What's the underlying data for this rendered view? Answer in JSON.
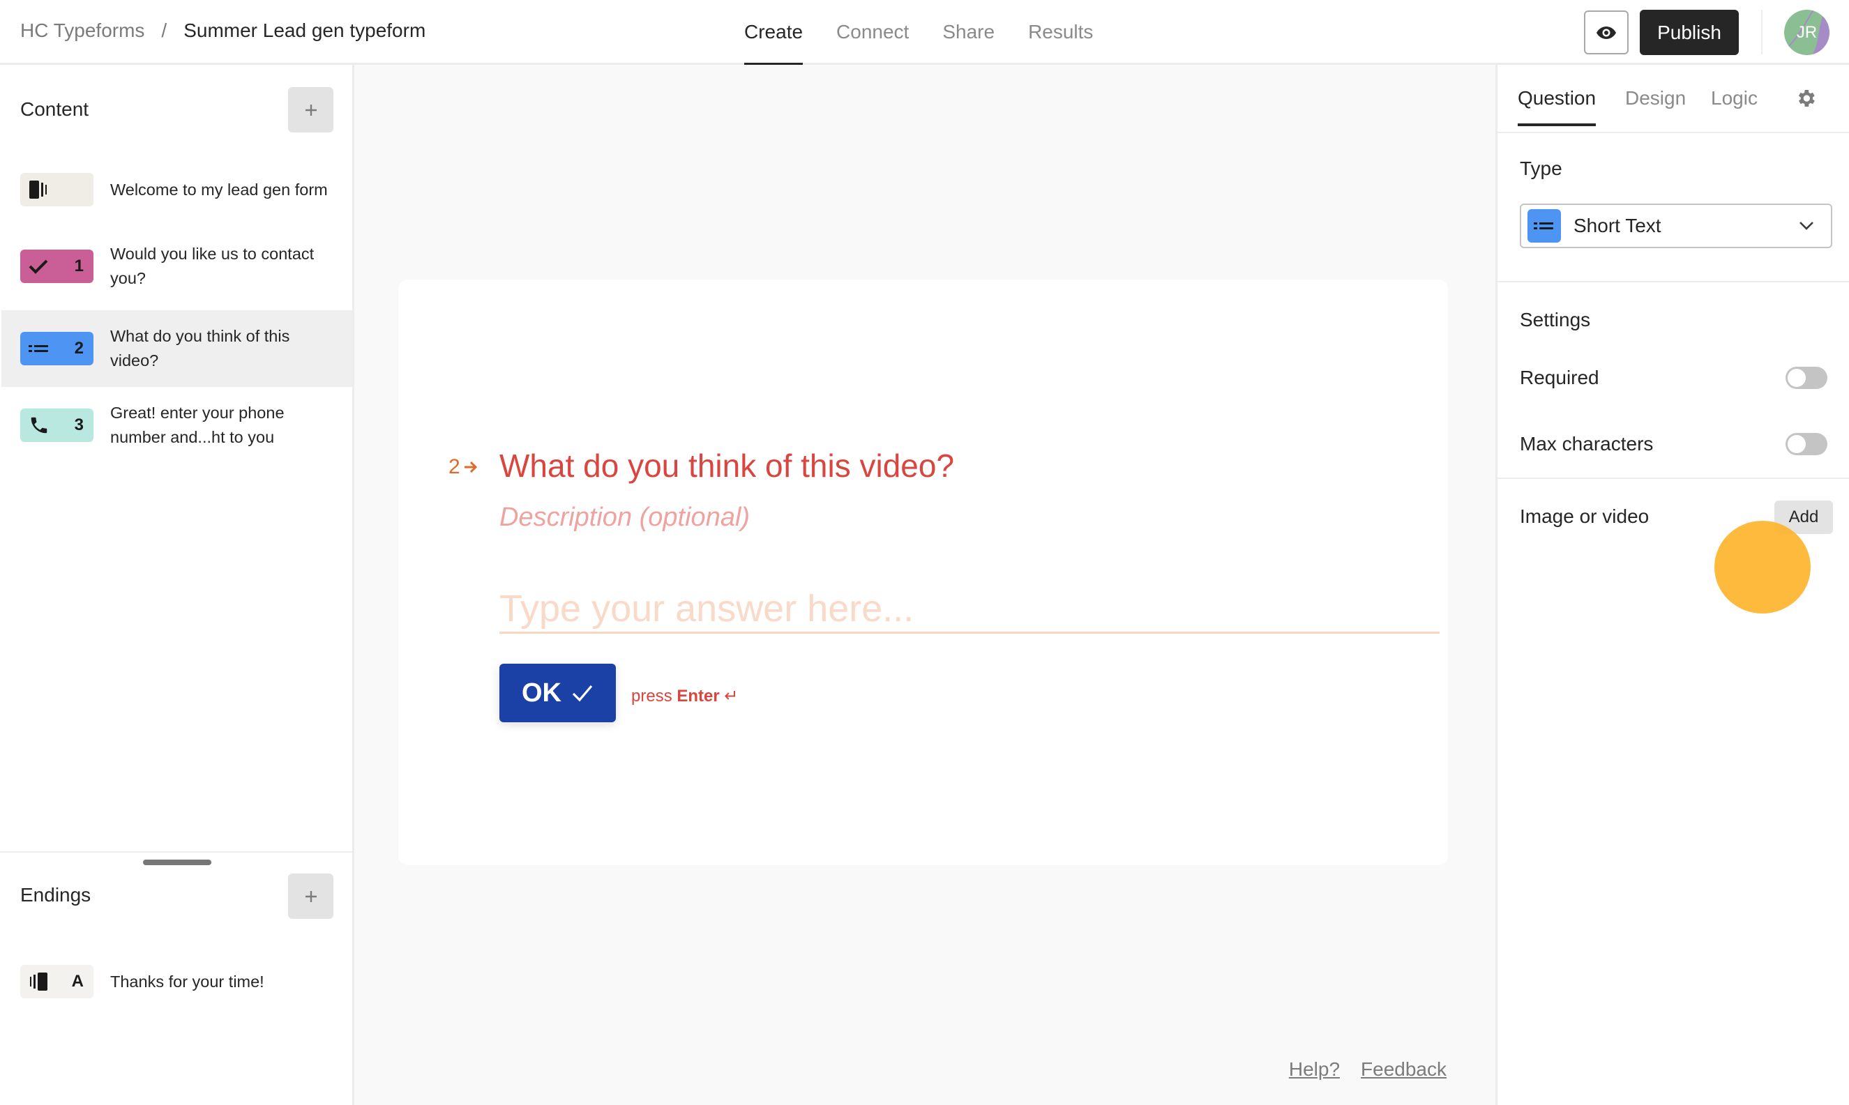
{
  "header": {
    "breadcrumb": {
      "workspace": "HC Typeforms",
      "separator": "/",
      "form_name": "Summer Lead gen typeform"
    },
    "tabs": [
      {
        "label": "Create",
        "active": true
      },
      {
        "label": "Connect",
        "active": false
      },
      {
        "label": "Share",
        "active": false
      },
      {
        "label": "Results",
        "active": false
      }
    ],
    "preview_icon": "eye-icon",
    "publish_label": "Publish",
    "avatar_initials": "JR"
  },
  "sidebar": {
    "content_title": "Content",
    "add_icon": "plus-icon",
    "questions": [
      {
        "badge_icon": "welcome-screen-icon",
        "number": "",
        "text": "Welcome to my lead gen form",
        "color": "#f0ece6",
        "selected": false
      },
      {
        "badge_icon": "checkmark-icon",
        "number": "1",
        "text": "Would you like us to contact you?",
        "color": "#c95f96",
        "selected": false
      },
      {
        "badge_icon": "short-text-icon",
        "number": "2",
        "text": "What do you think of this video?",
        "color": "#4e95f3",
        "selected": true
      },
      {
        "badge_icon": "phone-icon",
        "number": "3",
        "text": "Great! enter your phone number and...ht to you",
        "color": "#b9e8e0",
        "selected": false
      }
    ],
    "endings_title": "Endings",
    "endings": [
      {
        "badge_icon": "ending-screen-icon",
        "letter": "A",
        "text": "Thanks for your time!",
        "color": "#f4f2ee"
      }
    ]
  },
  "canvas": {
    "question_number": "2",
    "question_title": "What do you think of this video?",
    "description_placeholder": "Description (optional)",
    "answer_placeholder": "Type your answer here...",
    "ok_label": "OK",
    "press_label": "press",
    "enter_label": "Enter",
    "enter_symbol": "↵",
    "footer_links": [
      "Help?",
      "Feedback"
    ]
  },
  "right_panel": {
    "tabs": [
      {
        "label": "Question",
        "active": true
      },
      {
        "label": "Design",
        "active": false
      },
      {
        "label": "Logic",
        "active": false
      }
    ],
    "type_label": "Type",
    "type_value": "Short Text",
    "settings_label": "Settings",
    "settings": [
      {
        "label": "Required",
        "enabled": false
      },
      {
        "label": "Max characters",
        "enabled": false
      }
    ],
    "media_label": "Image or video",
    "media_add_label": "Add"
  },
  "colors": {
    "accent_question": "#d9463f",
    "ok_button": "#1c41a6",
    "short_text_blue": "#4e95f3",
    "cursor_highlight": "#fdb228"
  }
}
